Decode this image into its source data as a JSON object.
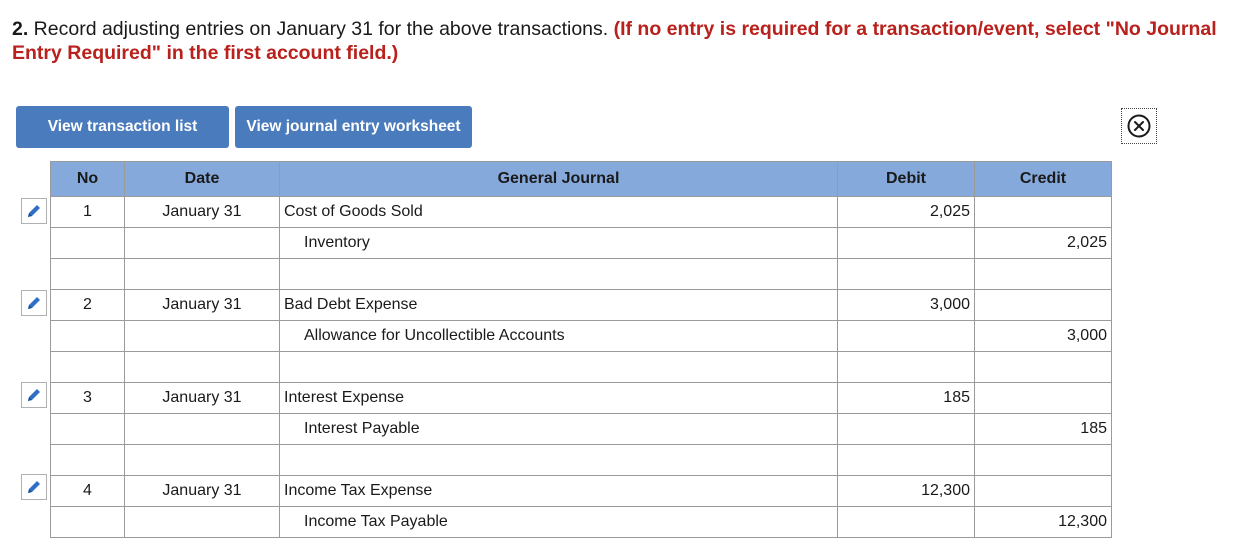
{
  "question": {
    "number": "2.",
    "text": " Record adjusting entries on January 31 for the above transactions. ",
    "note": "(If no entry is required for a transaction/event, select \"No Journal Entry Required\" in the first account field.)"
  },
  "buttons": {
    "view_transaction_list": "View transaction list",
    "view_journal_entry_worksheet": "View journal entry worksheet"
  },
  "table": {
    "headers": {
      "no": "No",
      "date": "Date",
      "general_journal": "General Journal",
      "debit": "Debit",
      "credit": "Credit"
    },
    "rows": [
      {
        "no": "1",
        "date": "January 31",
        "account": "Cost of Goods Sold",
        "debit": "2,025",
        "credit": ""
      },
      {
        "no": "",
        "date": "",
        "account": "Inventory",
        "debit": "",
        "credit": "2,025"
      },
      {
        "no": "",
        "date": "",
        "account": "",
        "debit": "",
        "credit": ""
      },
      {
        "no": "2",
        "date": "January 31",
        "account": "Bad Debt Expense",
        "debit": "3,000",
        "credit": ""
      },
      {
        "no": "",
        "date": "",
        "account": "Allowance for Uncollectible Accounts",
        "debit": "",
        "credit": "3,000"
      },
      {
        "no": "",
        "date": "",
        "account": "",
        "debit": "",
        "credit": ""
      },
      {
        "no": "3",
        "date": "January 31",
        "account": "Interest Expense",
        "debit": "185",
        "credit": ""
      },
      {
        "no": "",
        "date": "",
        "account": "Interest Payable",
        "debit": "",
        "credit": "185"
      },
      {
        "no": "",
        "date": "",
        "account": "",
        "debit": "",
        "credit": ""
      },
      {
        "no": "4",
        "date": "January 31",
        "account": "Income Tax Expense",
        "debit": "12,300",
        "credit": ""
      },
      {
        "no": "",
        "date": "",
        "account": "Income Tax Payable",
        "debit": "",
        "credit": "12,300"
      }
    ]
  },
  "icons": {
    "edit": "pencil-icon",
    "close": "close-circle-icon"
  },
  "colors": {
    "button_bg": "#4a7bbd",
    "header_bg": "#86a9dc",
    "instruction_red": "#b8211c",
    "pencil_blue": "#2f6fc7"
  }
}
